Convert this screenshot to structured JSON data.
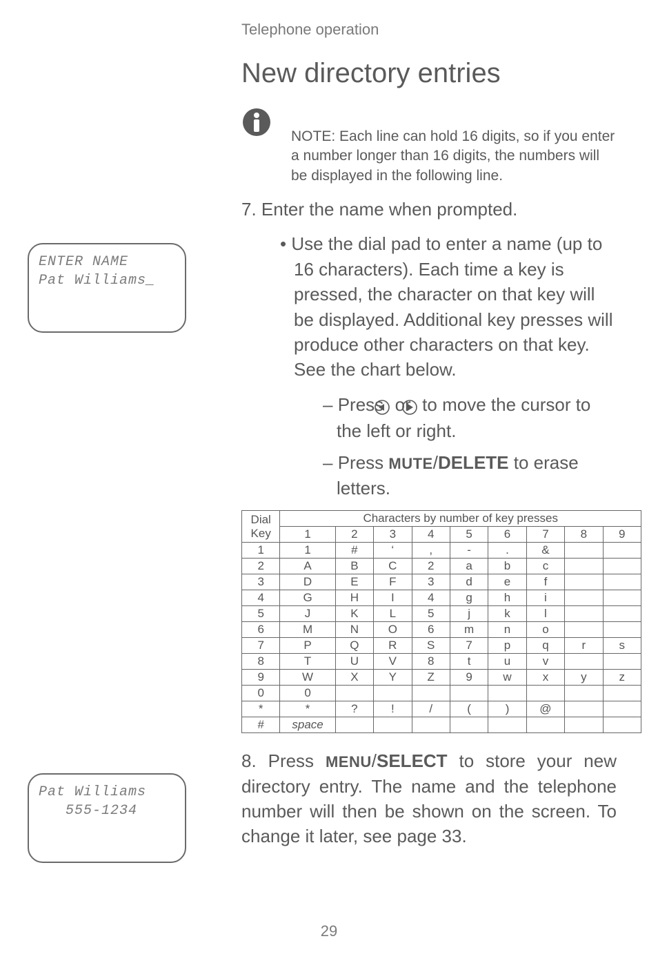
{
  "breadcrumb": "Telephone operation",
  "heading": "New directory entries",
  "note": {
    "label": "NOTE:",
    "body": "Each line can hold 16 digits, so if you enter a number longer than 16 digits, the numbers will be displayed in the following line."
  },
  "step7": {
    "text": "7. Enter the name when prompted.",
    "bullet": "Use the dial pad to enter a name (up to 16 characters). Each time a key is pressed, the character on that key will be displayed. Additional key presses will produce other characters on that key. See the chart below.",
    "dash1_a": "Press ",
    "dash1_b": " or ",
    "dash1_c": "  to move the cursor to the left or right.",
    "dash2_a": "Press ",
    "dash2_key1": "MUTE",
    "dash2_slash": "/",
    "dash2_key2": "DELETE",
    "dash2_b": " to erase letters."
  },
  "lcd1": {
    "line1": "ENTER NAME",
    "line2": "Pat Williams_"
  },
  "lcd2": {
    "line1": "Pat Williams",
    "line2": "   555-1234"
  },
  "step8": {
    "num": "8. Press ",
    "key1": "MENU",
    "slash": "/",
    "key2": "SELECT",
    "rest": " to store your new directory entry. The name and the telephone number will then be shown on the screen. To change it later, see page 33."
  },
  "page_num": "29",
  "chart_data": {
    "type": "table",
    "title": "Characters by number of key presses",
    "row_header": "Dial Key",
    "columns": [
      "1",
      "2",
      "3",
      "4",
      "5",
      "6",
      "7",
      "8",
      "9"
    ],
    "rows": [
      {
        "key": "1",
        "cells": [
          "1",
          "#",
          "‘",
          ",",
          "-",
          ".",
          "&",
          "",
          ""
        ]
      },
      {
        "key": "2",
        "cells": [
          "A",
          "B",
          "C",
          "2",
          "a",
          "b",
          "c",
          "",
          ""
        ]
      },
      {
        "key": "3",
        "cells": [
          "D",
          "E",
          "F",
          "3",
          "d",
          "e",
          "f",
          "",
          ""
        ]
      },
      {
        "key": "4",
        "cells": [
          "G",
          "H",
          "I",
          "4",
          "g",
          "h",
          "i",
          "",
          ""
        ]
      },
      {
        "key": "5",
        "cells": [
          "J",
          "K",
          "L",
          "5",
          "j",
          "k",
          "l",
          "",
          ""
        ]
      },
      {
        "key": "6",
        "cells": [
          "M",
          "N",
          "O",
          "6",
          "m",
          "n",
          "o",
          "",
          ""
        ]
      },
      {
        "key": "7",
        "cells": [
          "P",
          "Q",
          "R",
          "S",
          "7",
          "p",
          "q",
          "r",
          "s"
        ]
      },
      {
        "key": "8",
        "cells": [
          "T",
          "U",
          "V",
          "8",
          "t",
          "u",
          "v",
          "",
          ""
        ]
      },
      {
        "key": "9",
        "cells": [
          "W",
          "X",
          "Y",
          "Z",
          "9",
          "w",
          "x",
          "y",
          "z"
        ]
      },
      {
        "key": "0",
        "cells": [
          "0",
          "",
          "",
          "",
          "",
          "",
          "",
          "",
          ""
        ]
      },
      {
        "key": "*",
        "cells": [
          "*",
          "?",
          "!",
          "/",
          "(",
          ")",
          "@",
          "",
          ""
        ]
      },
      {
        "key": "#",
        "cells": [
          "space",
          "",
          "",
          "",
          "",
          "",
          "",
          "",
          ""
        ]
      }
    ]
  }
}
